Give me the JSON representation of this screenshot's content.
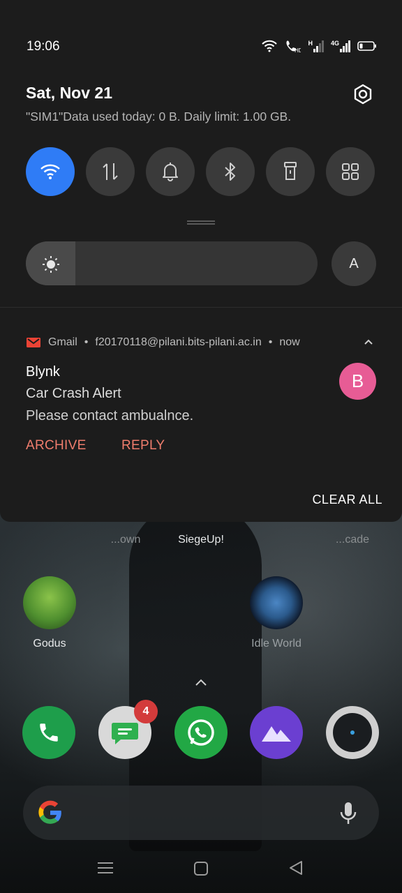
{
  "status_bar": {
    "time": "19:06",
    "signal_labels": [
      "H",
      "4G"
    ]
  },
  "shade": {
    "date": "Sat, Nov 21",
    "data_usage": "\"SIM1\"Data used today: 0 B. Daily limit: 1.00 GB.",
    "brightness": {
      "level": 0.17,
      "auto_label": "A"
    },
    "tiles": [
      {
        "name": "wifi",
        "on": true
      },
      {
        "name": "mobile-data",
        "on": false
      },
      {
        "name": "sound",
        "on": false
      },
      {
        "name": "bluetooth",
        "on": false
      },
      {
        "name": "flashlight",
        "on": false
      },
      {
        "name": "more",
        "on": false
      }
    ],
    "accent": "#2f7cf6"
  },
  "notification": {
    "app": "Gmail",
    "account": "f20170118@pilani.bits-pilani.ac.in",
    "time": "now",
    "title": "Blynk",
    "subtitle": "Car Crash Alert",
    "body": "Please contact ambualnce.",
    "avatar_letter": "B",
    "actions": [
      "ARCHIVE",
      "REPLY"
    ],
    "clear_all": "CLEAR ALL"
  },
  "home": {
    "apps": [
      {
        "label": "...own"
      },
      {
        "label": "SiegeUp!"
      },
      {
        "label": "...cade"
      },
      {
        "label": "Godus"
      },
      {
        "label": "Idle World"
      }
    ],
    "dock": [
      "Phone",
      "Messages",
      "WhatsApp",
      "Gallery",
      "Camera"
    ],
    "messages_badge": "4"
  }
}
